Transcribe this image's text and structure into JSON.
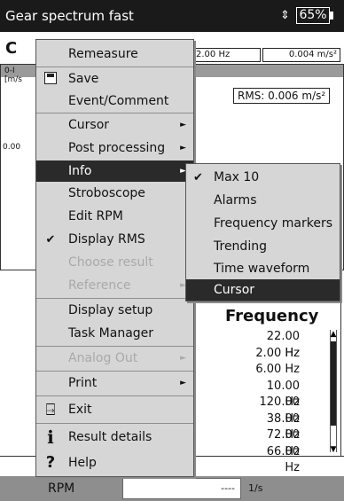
{
  "titlebar": {
    "title": "Gear spectrum fast",
    "battery": "65%",
    "battery_icon": "⇕"
  },
  "background": {
    "heading": "C",
    "hz_value": "2.00 Hz",
    "acc_value": "0.004 m/s²",
    "y_top": "0-I",
    "y_unit": "[m/s",
    "y_mid": "0.00",
    "rms": "RMS: 0.006 m/s²",
    "freq_title": "Frequency",
    "freq_values": [
      "22.00 Hz",
      "2.00 Hz",
      "6.00 Hz",
      "10.00 Hz",
      "120.00 Hz",
      "38.00 Hz",
      "72.00 Hz",
      "66.00 Hz"
    ]
  },
  "statusbar": {
    "label": "RPM",
    "value": "----",
    "unit": "1/s"
  },
  "menu": {
    "items": [
      {
        "label": "Remeasure"
      },
      {
        "label": "Save",
        "icon": "save-icon"
      },
      {
        "label": "Event/Comment"
      },
      {
        "label": "Cursor",
        "submenu": true
      },
      {
        "label": "Post processing",
        "submenu": true
      },
      {
        "label": "Info",
        "submenu": true,
        "selected": true
      },
      {
        "label": "Stroboscope"
      },
      {
        "label": "Edit RPM"
      },
      {
        "label": "Display RMS",
        "checked": true
      },
      {
        "label": "Choose result",
        "disabled": true
      },
      {
        "label": "Reference",
        "disabled": true,
        "submenu": true
      },
      {
        "label": "Display setup"
      },
      {
        "label": "Task Manager"
      },
      {
        "label": "Analog Out",
        "disabled": true,
        "submenu": true
      },
      {
        "label": "Print",
        "submenu": true
      },
      {
        "label": "Exit",
        "icon": "exit-icon"
      },
      {
        "label": "Result details",
        "icon": "info-icon"
      },
      {
        "label": "Help",
        "icon": "help-icon"
      }
    ],
    "arrow": "►",
    "check": "✔"
  },
  "submenu": {
    "items": [
      {
        "label": "Max 10",
        "checked": true
      },
      {
        "label": "Alarms"
      },
      {
        "label": "Frequency markers"
      },
      {
        "label": "Trending"
      },
      {
        "label": "Time waveform"
      },
      {
        "label": "Cursor",
        "selected": true
      }
    ]
  },
  "icons": {
    "up": "▲",
    "down": "▼",
    "exit": "⍈",
    "info": "ℹ",
    "help": "?"
  }
}
